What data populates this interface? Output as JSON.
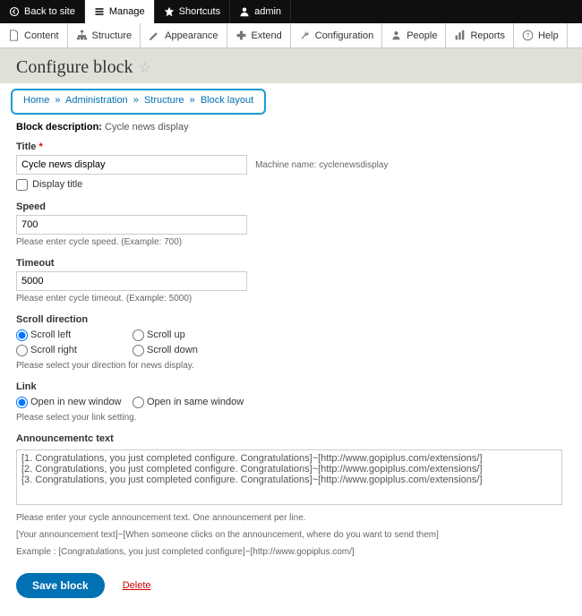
{
  "toolbar": {
    "backToSite": "Back to site",
    "manage": "Manage",
    "shortcuts": "Shortcuts",
    "user": "admin"
  },
  "adminTabs": {
    "content": "Content",
    "structure": "Structure",
    "appearance": "Appearance",
    "extend": "Extend",
    "configuration": "Configuration",
    "people": "People",
    "reports": "Reports",
    "help": "Help"
  },
  "page": {
    "title": "Configure block"
  },
  "breadcrumb": {
    "home": "Home",
    "administration": "Administration",
    "structure": "Structure",
    "blockLayout": "Block layout"
  },
  "blockDescription": {
    "label": "Block description: ",
    "value": "Cycle news display"
  },
  "form": {
    "title": {
      "label": "Title",
      "value": "Cycle news display",
      "machineName": "Machine name: cyclenewsdisplay"
    },
    "displayTitle": {
      "label": "Display title"
    },
    "speed": {
      "label": "Speed",
      "value": "700",
      "description": "Please enter cycle speed. (Example: 700)"
    },
    "timeout": {
      "label": "Timeout",
      "value": "5000",
      "description": "Please enter cycle timeout. (Example: 5000)"
    },
    "scrollDirection": {
      "label": "Scroll direction",
      "options": {
        "left": "Scroll left",
        "up": "Scroll up",
        "right": "Scroll right",
        "down": "Scroll down"
      },
      "description": "Please select your direction for news display."
    },
    "link": {
      "label": "Link",
      "options": {
        "newWindow": "Open in new window",
        "sameWindow": "Open in same window"
      },
      "description": "Please select your link setting."
    },
    "announcement": {
      "label": "Announcementc text",
      "value": "[1. Congratulations, you just completed configure. Congratulations]~[http://www.gopiplus.com/extensions/]\n[2. Congratulations, you just completed configure. Congratulations]~[http://www.gopiplus.com/extensions/]\n[3. Congratulations, you just completed configure. Congratulations]~[http://www.gopiplus.com/extensions/]",
      "help1": "Please enter your cycle announcement text. One announcement per line.",
      "help2": "[Your announcement text]~[When someone clicks on the announcement, where do you want to send them]",
      "help3": "Example : [Congratulations, you just completed configure]~[http://www.gopiplus.com/]"
    }
  },
  "actions": {
    "save": "Save block",
    "delete": "Delete"
  }
}
